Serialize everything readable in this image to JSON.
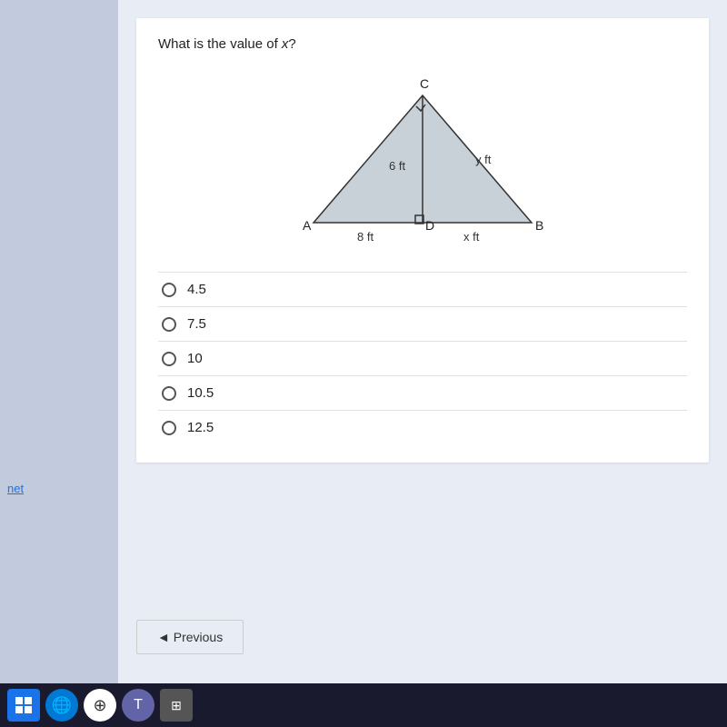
{
  "page": {
    "background": "#d0d8e8"
  },
  "question": {
    "text": "What is the value of ",
    "variable": "x",
    "text_suffix": "?",
    "diagram": {
      "vertex_a": "A",
      "vertex_b": "B",
      "vertex_c": "C",
      "vertex_d": "D",
      "label_ad": "8 ft",
      "label_cd": "6 ft",
      "label_db": "x ft",
      "label_cb": "y ft"
    },
    "options": [
      {
        "value": "4.5",
        "label": "4.5"
      },
      {
        "value": "7.5",
        "label": "7.5"
      },
      {
        "value": "10",
        "label": "10"
      },
      {
        "value": "10.5",
        "label": "10.5"
      },
      {
        "value": "12.5",
        "label": "12.5"
      }
    ]
  },
  "navigation": {
    "previous_label": "◄ Previous"
  },
  "sidebar": {
    "net_label": "net"
  }
}
